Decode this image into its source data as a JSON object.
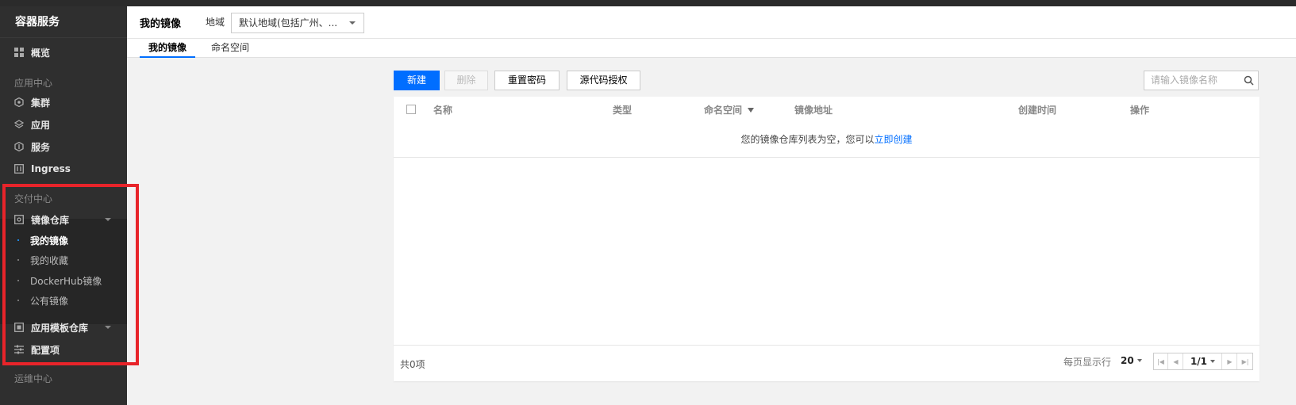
{
  "sidebar": {
    "title": "容器服务",
    "overview": "概览",
    "app_center": "应用中心",
    "cluster": "集群",
    "application": "应用",
    "service": "服务",
    "ingress": "Ingress",
    "delivery_center": "交付中心",
    "image_repo": "镜像仓库",
    "my_images": "我的镜像",
    "my_favorites": "我的收藏",
    "dockerhub_images": "DockerHub镜像",
    "public_images": "公有镜像",
    "app_template_repo": "应用模板仓库",
    "config_items": "配置项",
    "ops_center": "运维中心"
  },
  "header": {
    "title": "我的镜像",
    "region_label": "地域",
    "region_value": "默认地域(包括广州、..."
  },
  "tabs": [
    "我的镜像",
    "命名空间"
  ],
  "toolbar": {
    "new": "新建",
    "delete": "删除",
    "reset_password": "重置密码",
    "source_auth": "源代码授权",
    "search_placeholder": "请输入镜像名称"
  },
  "table": {
    "columns": [
      "名称",
      "类型",
      "命名空间",
      "镜像地址",
      "创建时间",
      "操作"
    ],
    "empty_text": "您的镜像仓库列表为空，您可以",
    "empty_link": "立即创建"
  },
  "footer": {
    "total": "共0项",
    "per_page_label": "每页显示行",
    "per_page_value": "20",
    "page": "1/1"
  },
  "colors": {
    "accent": "#006eff",
    "sidebar_bg": "#2f2f2f",
    "highlight": "#e8242a"
  }
}
